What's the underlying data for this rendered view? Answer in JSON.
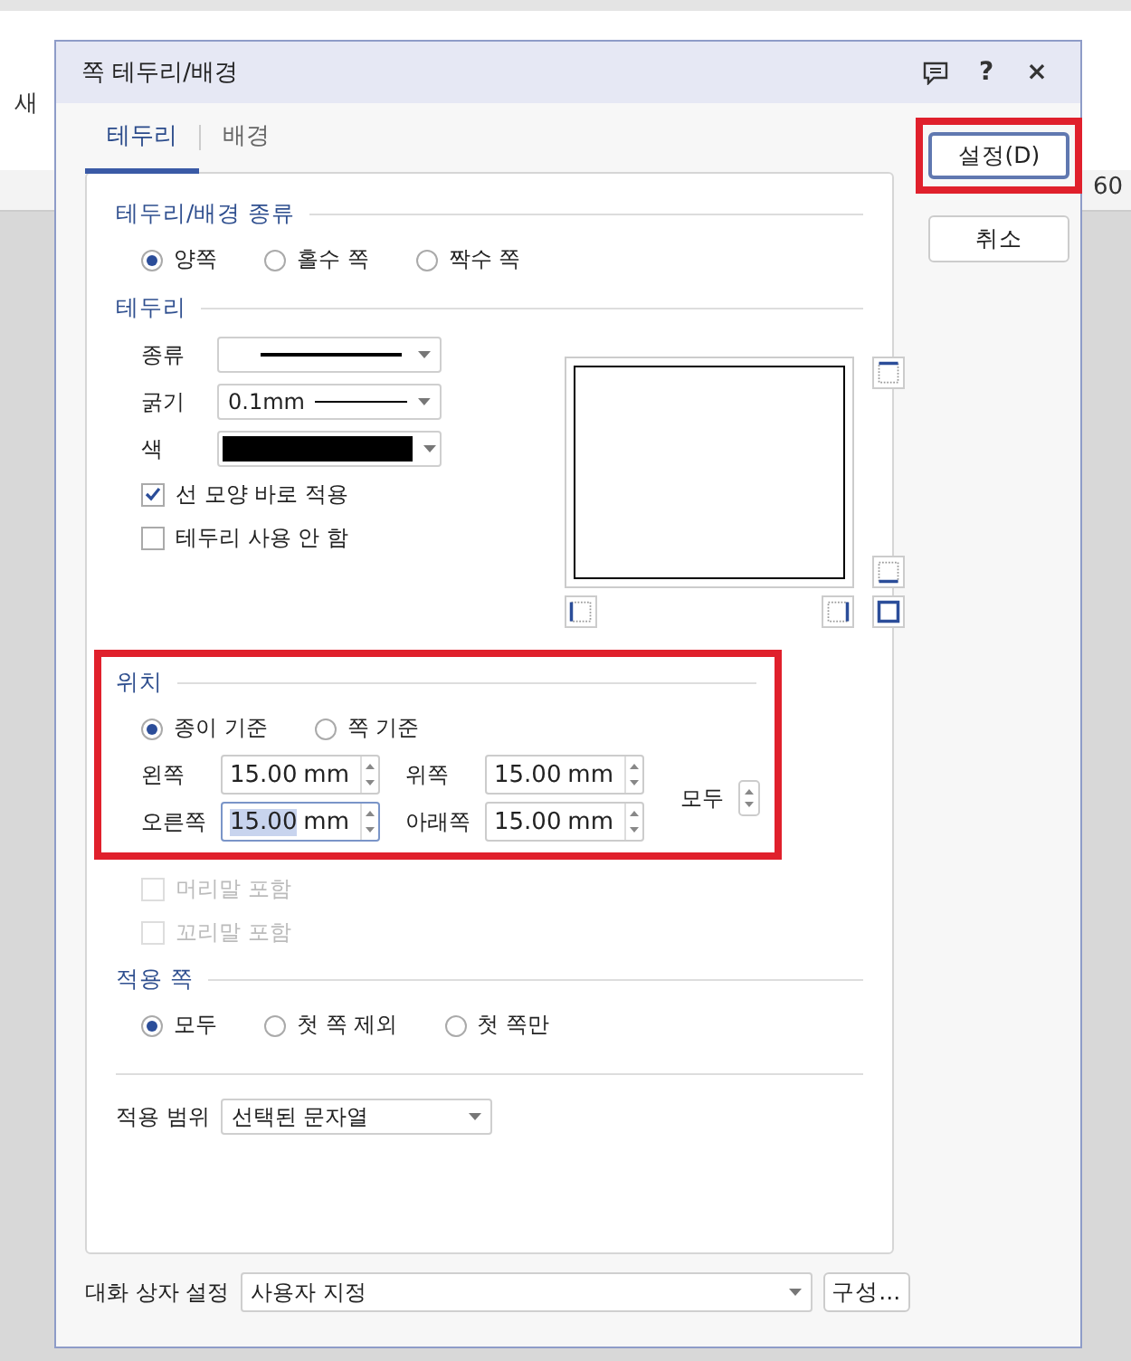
{
  "background_app": {
    "texts": [
      "새",
      "60"
    ]
  },
  "dialog": {
    "title": "쪽 테두리/배경",
    "title_buttons": [
      {
        "kind": "comment"
      },
      {
        "kind": "text",
        "label": "?"
      },
      {
        "kind": "text",
        "label": "×"
      }
    ]
  },
  "tabs": [
    {
      "label": "테두리",
      "selected": true
    },
    {
      "label": "배경",
      "selected": false
    }
  ],
  "side_buttons": [
    {
      "label": "설정(D)",
      "highlighted": true
    },
    {
      "label": "취소",
      "highlighted": false
    }
  ],
  "type_section": {
    "title": "테두리/배경 종류",
    "options": [
      {
        "label": "양쪽",
        "selected": true
      },
      {
        "label": "홀수 쪽",
        "selected": false
      },
      {
        "label": "짝수 쪽",
        "selected": false
      }
    ]
  },
  "border_section": {
    "title": "테두리",
    "line_type": {
      "label": "종류"
    },
    "thickness": {
      "label": "굵기",
      "value": "0.1mm"
    },
    "color": {
      "label": "색",
      "color": "#000000"
    },
    "checkboxes": [
      {
        "label": "선 모양 바로 적용",
        "checked": true
      },
      {
        "label": "테두리 사용 안 함",
        "checked": false
      }
    ]
  },
  "position_section": {
    "title": "위치",
    "highlighted": true,
    "basis": [
      {
        "label": "종이 기준",
        "selected": true
      },
      {
        "label": "쪽 기준",
        "selected": false
      }
    ],
    "margins": [
      {
        "label": "왼쪽",
        "value": "15.00",
        "unit": "mm",
        "focused": false
      },
      {
        "label": "위쪽",
        "value": "15.00",
        "unit": "mm",
        "focused": false
      },
      {
        "label": "오른쪽",
        "value": "15.00",
        "unit": "mm",
        "focused": true
      },
      {
        "label": "아래쪽",
        "value": "15.00",
        "unit": "mm",
        "focused": false
      }
    ],
    "all_label": "모두"
  },
  "include": [
    {
      "label": "머리말 포함",
      "checked": false,
      "disabled": true
    },
    {
      "label": "꼬리말 포함",
      "checked": false,
      "disabled": true
    }
  ],
  "apply_pages": {
    "title": "적용 쪽",
    "options": [
      {
        "label": "모두",
        "selected": true
      },
      {
        "label": "첫 쪽 제외",
        "selected": false
      },
      {
        "label": "첫 쪽만",
        "selected": false
      }
    ]
  },
  "apply_range": {
    "label": "적용 범위",
    "value": "선택된 문자열"
  },
  "footer": {
    "label": "대화 상자 설정",
    "value": "사용자 지정",
    "button": "구성..."
  }
}
